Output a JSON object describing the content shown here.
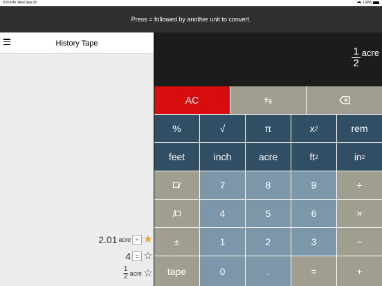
{
  "status_bar": {
    "time": "9:25 PM",
    "date": "Wed Sep 29",
    "battery": "100%"
  },
  "banner": {
    "text": "Press = followed by another unit to convert."
  },
  "history": {
    "title": "History Tape",
    "rows": [
      {
        "value": "2.01",
        "unit": "acre",
        "op": "÷",
        "starred": true
      },
      {
        "value": "4",
        "unit": "",
        "op": "=",
        "starred": false
      },
      {
        "num": "1",
        "den": "2",
        "unit": "acre",
        "starred": false
      }
    ]
  },
  "display": {
    "num": "1",
    "den": "2",
    "unit": "acre"
  },
  "keys": {
    "ac": "AC",
    "swap": "⇆",
    "percent": "%",
    "sqrt": "√",
    "pi": "π",
    "x": "x",
    "two": "2",
    "rem": "rem",
    "feet": "feet",
    "inch": "inch",
    "acre": "acre",
    "ft": "ft",
    "in": "in",
    "div": "÷",
    "times": "×",
    "minus": "−",
    "plus": "+",
    "plusminus": "±",
    "tape": "tape",
    "zero": "0",
    "one": "1",
    "two_d": "2",
    "three": "3",
    "four": "4",
    "five": "5",
    "six": "6",
    "seven": "7",
    "eight": "8",
    "nine": "9",
    "dot": ".",
    "equals": "=",
    "slash": "/"
  },
  "colors": {
    "red": "#d70c0c",
    "tan": "#a09e8e",
    "navy": "#304f65",
    "slate": "#7d97aa",
    "star": "#f0a321"
  }
}
